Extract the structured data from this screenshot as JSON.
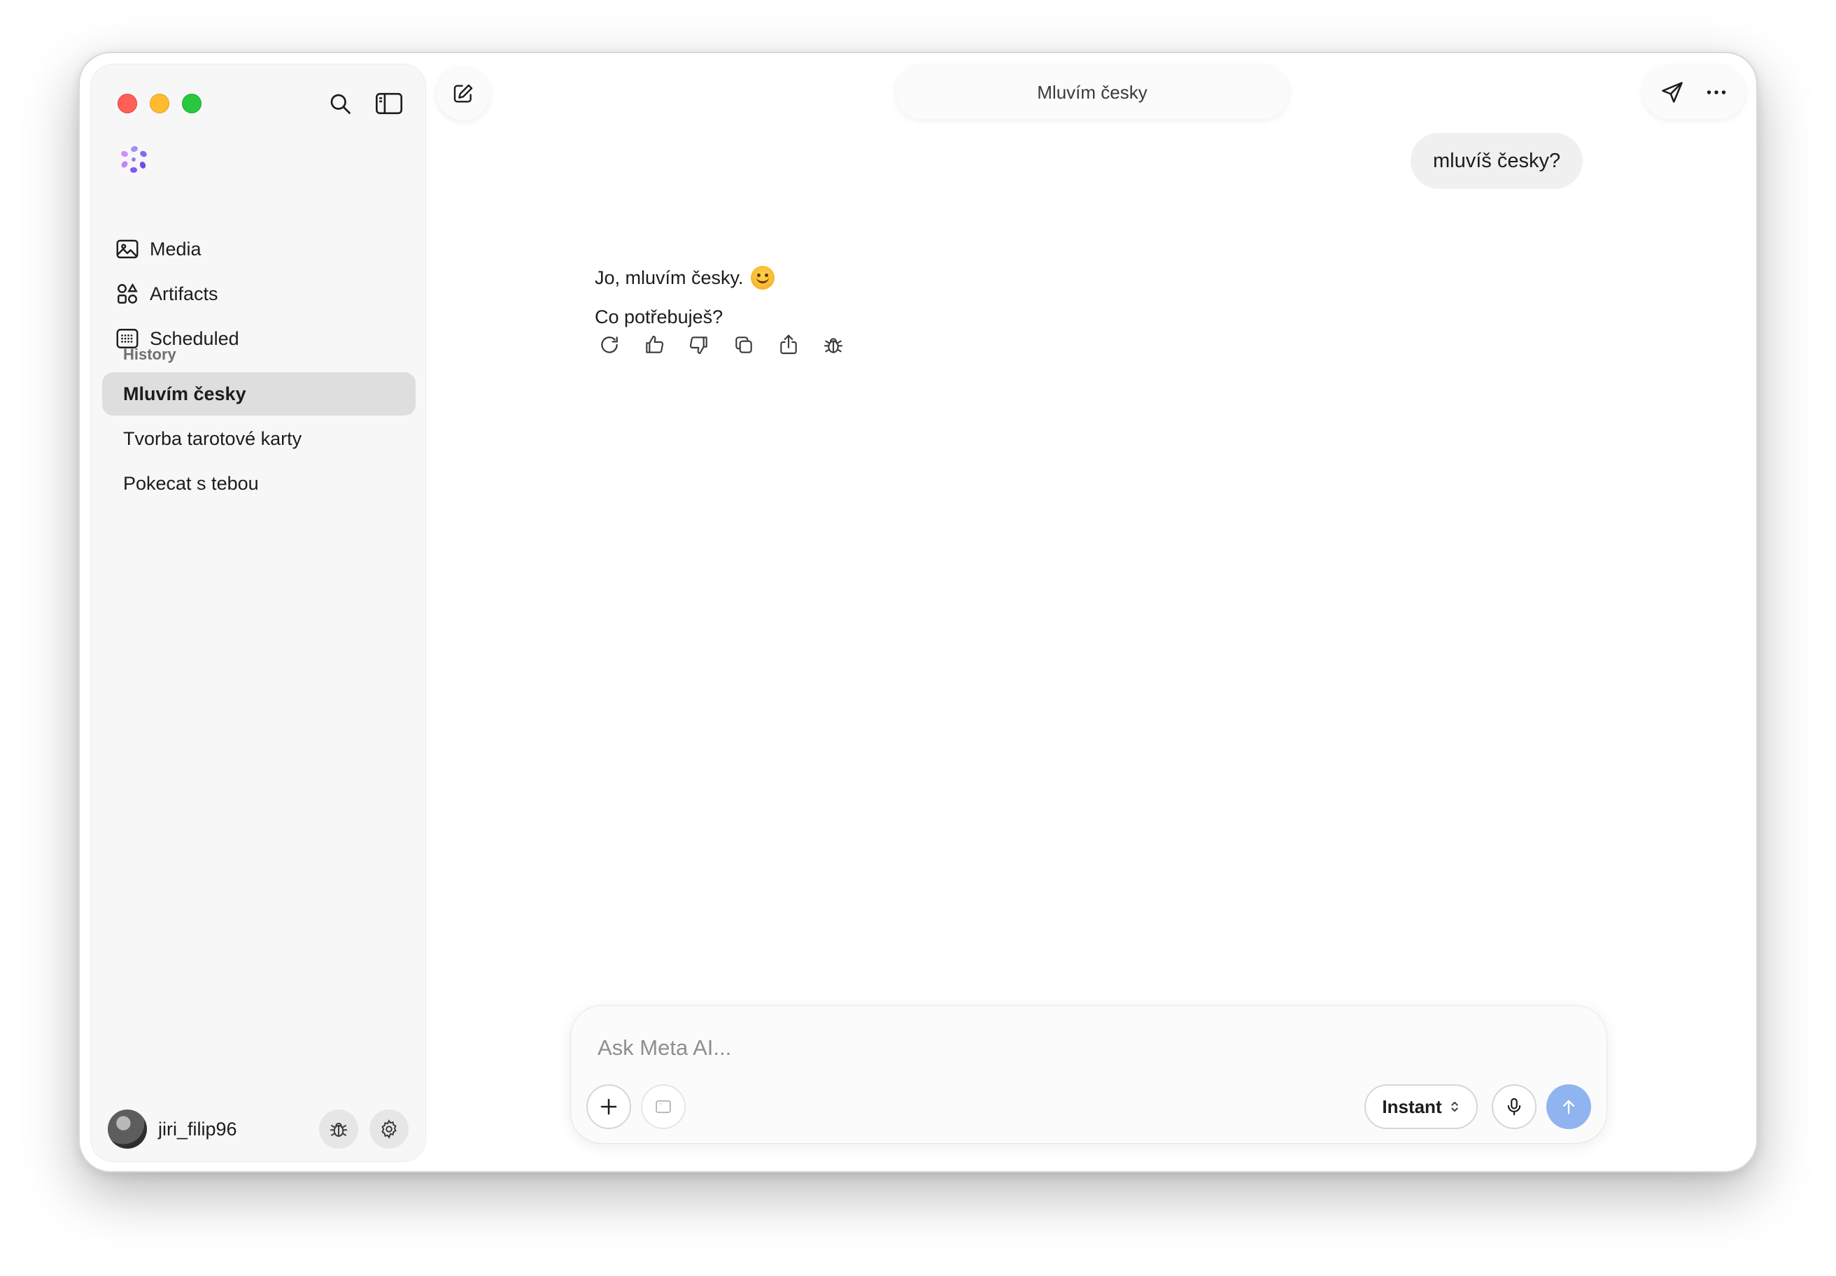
{
  "window": {
    "title": "Mluvím česky"
  },
  "sidebar": {
    "nav": [
      {
        "label": "Media",
        "icon": "image-icon"
      },
      {
        "label": "Artifacts",
        "icon": "shapes-icon"
      },
      {
        "label": "Scheduled",
        "icon": "calendar-icon"
      }
    ],
    "history_label": "History",
    "history": [
      {
        "label": "Mluvím česky",
        "active": true
      },
      {
        "label": "Tvorba tarotové karty",
        "active": false
      },
      {
        "label": "Pokecat s tebou",
        "active": false
      }
    ],
    "user": {
      "name": "jiri_filip96"
    }
  },
  "chat": {
    "user_message": "mluvíš česky?",
    "ai_lines": [
      "Jo, mluvím česky.",
      "Co potřebuješ?"
    ],
    "actions": [
      "regenerate-icon",
      "thumbs-up-icon",
      "thumbs-down-icon",
      "copy-icon",
      "share-icon",
      "bug-icon"
    ]
  },
  "composer": {
    "placeholder": "Ask Meta AI...",
    "mode": "Instant"
  },
  "colors": {
    "accent_send": "#8fb4ef",
    "active_history_bg": "#dedede",
    "sidebar_bg": "#f7f7f7"
  }
}
